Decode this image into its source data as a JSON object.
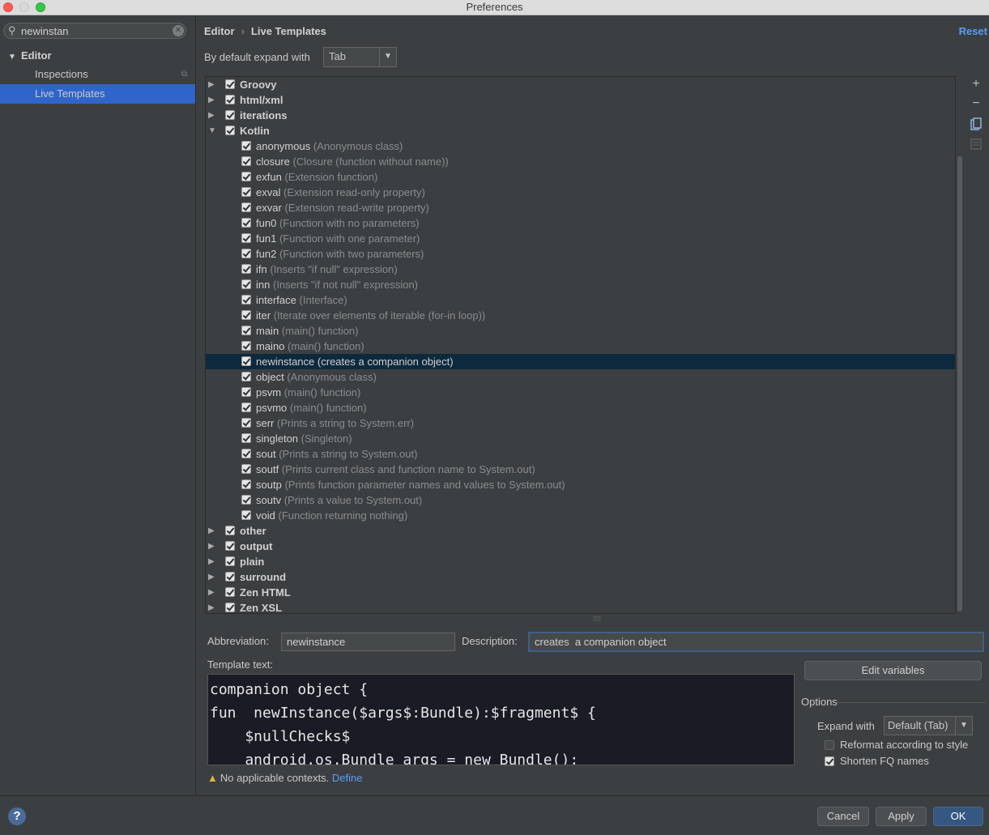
{
  "window": {
    "title": "Preferences"
  },
  "search": {
    "value": "newinstan"
  },
  "sidebar": {
    "group": "Editor",
    "items": [
      {
        "label": "Inspections",
        "selected": false
      },
      {
        "label": "Live Templates",
        "selected": true
      }
    ]
  },
  "header": {
    "breadcrumb": [
      "Editor",
      "Live Templates"
    ],
    "separator": "›",
    "reset_label": "Reset"
  },
  "expand_default": {
    "label": "By default expand with",
    "value": "Tab"
  },
  "tree": {
    "groups_before": [
      {
        "name": "Groovy",
        "expanded": false,
        "checked": true
      },
      {
        "name": "html/xml",
        "expanded": false,
        "checked": true
      },
      {
        "name": "iterations",
        "expanded": false,
        "checked": true
      }
    ],
    "expanded_group": {
      "name": "Kotlin",
      "expanded": true,
      "checked": true
    },
    "templates": [
      {
        "abbr": "anonymous",
        "desc": "(Anonymous class)"
      },
      {
        "abbr": "closure",
        "desc": "(Closure (function without name))"
      },
      {
        "abbr": "exfun",
        "desc": "(Extension function)"
      },
      {
        "abbr": "exval",
        "desc": "(Extension read-only property)"
      },
      {
        "abbr": "exvar",
        "desc": "(Extension read-write property)"
      },
      {
        "abbr": "fun0",
        "desc": "(Function with no parameters)"
      },
      {
        "abbr": "fun1",
        "desc": "(Function with one parameter)"
      },
      {
        "abbr": "fun2",
        "desc": "(Function with two parameters)"
      },
      {
        "abbr": "ifn",
        "desc": "(Inserts \"if null\" expression)"
      },
      {
        "abbr": "inn",
        "desc": "(Inserts \"if not null\" expression)"
      },
      {
        "abbr": "interface",
        "desc": "(Interface)"
      },
      {
        "abbr": "iter",
        "desc": "(Iterate over elements of iterable (for-in loop))"
      },
      {
        "abbr": "main",
        "desc": "(main() function)"
      },
      {
        "abbr": "maino",
        "desc": "(main() function)"
      },
      {
        "abbr": "newinstance",
        "desc": "(creates  a companion object)",
        "selected": true
      },
      {
        "abbr": "object",
        "desc": "(Anonymous class)"
      },
      {
        "abbr": "psvm",
        "desc": "(main() function)"
      },
      {
        "abbr": "psvmo",
        "desc": "(main() function)"
      },
      {
        "abbr": "serr",
        "desc": "(Prints a string to System.err)"
      },
      {
        "abbr": "singleton",
        "desc": "(Singleton)"
      },
      {
        "abbr": "sout",
        "desc": "(Prints a string to System.out)"
      },
      {
        "abbr": "soutf",
        "desc": "(Prints current class and function name to System.out)"
      },
      {
        "abbr": "soutp",
        "desc": "(Prints function parameter names and values to System.out)"
      },
      {
        "abbr": "soutv",
        "desc": "(Prints a value to System.out)"
      },
      {
        "abbr": "void",
        "desc": "(Function returning nothing)"
      }
    ],
    "groups_after": [
      {
        "name": "other",
        "expanded": false,
        "checked": true
      },
      {
        "name": "output",
        "expanded": false,
        "checked": true
      },
      {
        "name": "plain",
        "expanded": false,
        "checked": true
      },
      {
        "name": "surround",
        "expanded": false,
        "checked": true
      },
      {
        "name": "Zen HTML",
        "expanded": false,
        "checked": true
      },
      {
        "name": "Zen XSL",
        "expanded": false,
        "checked": true
      }
    ]
  },
  "side_toolbar": {
    "icons": [
      "add-icon",
      "remove-icon",
      "copy-icon",
      "restore-icon"
    ],
    "add": "+",
    "remove": "−"
  },
  "editor": {
    "abbreviation_label": "Abbreviation:",
    "abbreviation_value": "newinstance",
    "description_label": "Description:",
    "description_value": "creates  a companion object",
    "template_text_label": "Template text:",
    "template_lines": [
      "companion object {",
      "fun  newInstance($args$:Bundle):$fragment$ {",
      "    $nullChecks$",
      "    android.os.Bundle args = new Bundle();"
    ],
    "edit_variables_label": "Edit variables",
    "warning_text": "No applicable contexts.",
    "warning_link": "Define"
  },
  "options": {
    "label": "Options",
    "expand_with_label": "Expand with",
    "expand_with_value": "Default (Tab)",
    "reformat_label": "Reformat according to style",
    "reformat_checked": false,
    "shorten_label": "Shorten FQ names",
    "shorten_checked": true
  },
  "footer": {
    "help": "?",
    "cancel_label": "Cancel",
    "apply_label": "Apply",
    "ok_label": "OK"
  },
  "colors": {
    "background": "#3c3f41",
    "selection": "#2f65ca",
    "row_selection": "#0d293e",
    "link": "#589df6",
    "primary_button": "#365880"
  }
}
